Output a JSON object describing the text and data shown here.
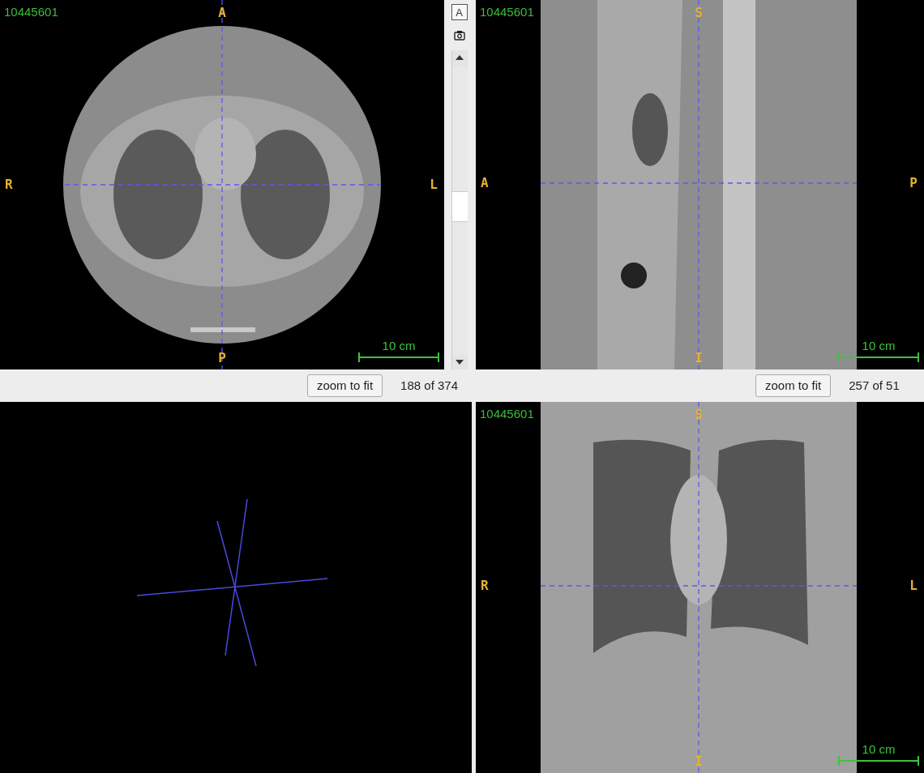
{
  "viewports": [
    {
      "kind": "axial",
      "patient_id": "10445601",
      "labels": {
        "top": "A",
        "bottom": "P",
        "left": "R",
        "right": "L"
      },
      "scale_label": "10 cm"
    },
    {
      "kind": "sagittal",
      "patient_id": "10445601",
      "labels": {
        "top": "S",
        "bottom": "I",
        "left": "A",
        "right": "P"
      },
      "scale_label": "10 cm"
    },
    {
      "kind": "volume"
    },
    {
      "kind": "coronal",
      "patient_id": "10445601",
      "labels": {
        "top": "S",
        "bottom": "I",
        "left": "R",
        "right": "L"
      },
      "scale_label": "10 cm"
    }
  ],
  "side_toolbar": {
    "annotation_button": "A"
  },
  "status_bars": [
    {
      "button": "zoom to fit",
      "slice": "188 of 374"
    },
    {
      "button": "zoom to fit",
      "slice": "257 of 51"
    }
  ]
}
